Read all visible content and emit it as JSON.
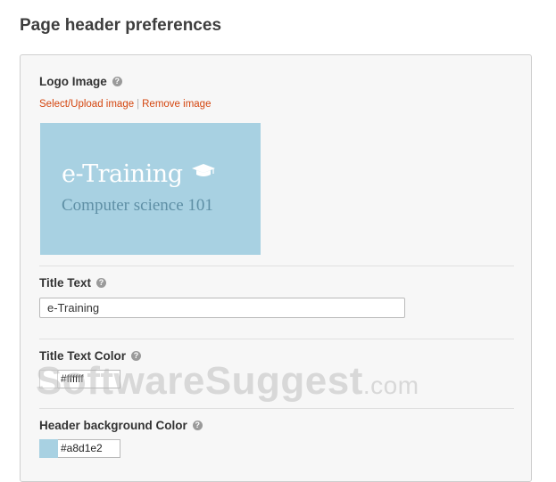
{
  "page": {
    "title": "Page header preferences"
  },
  "logo": {
    "label": "Logo Image",
    "help_icon": "question-circle-icon",
    "select_link": "Select/Upload image",
    "separator": "|",
    "remove_link": "Remove image",
    "preview": {
      "title": "e-Training",
      "subtitle": "Computer science 101",
      "icon": "graduation-cap-icon",
      "background": "#a8d1e2"
    }
  },
  "title_text": {
    "label": "Title Text",
    "help_icon": "question-circle-icon",
    "value": "e-Training"
  },
  "title_text_color": {
    "label": "Title Text Color",
    "help_icon": "question-circle-icon",
    "value": "#ffffff",
    "swatch": "#ffffff"
  },
  "header_bg_color": {
    "label": "Header background Color",
    "help_icon": "question-circle-icon",
    "value": "#a8d1e2",
    "swatch": "#a8d1e2"
  },
  "colors": {
    "link": "#d4460f",
    "panel_bg": "#f7f7f7"
  },
  "watermark": {
    "main": "SoftwareSuggest",
    "suffix": ".com"
  }
}
